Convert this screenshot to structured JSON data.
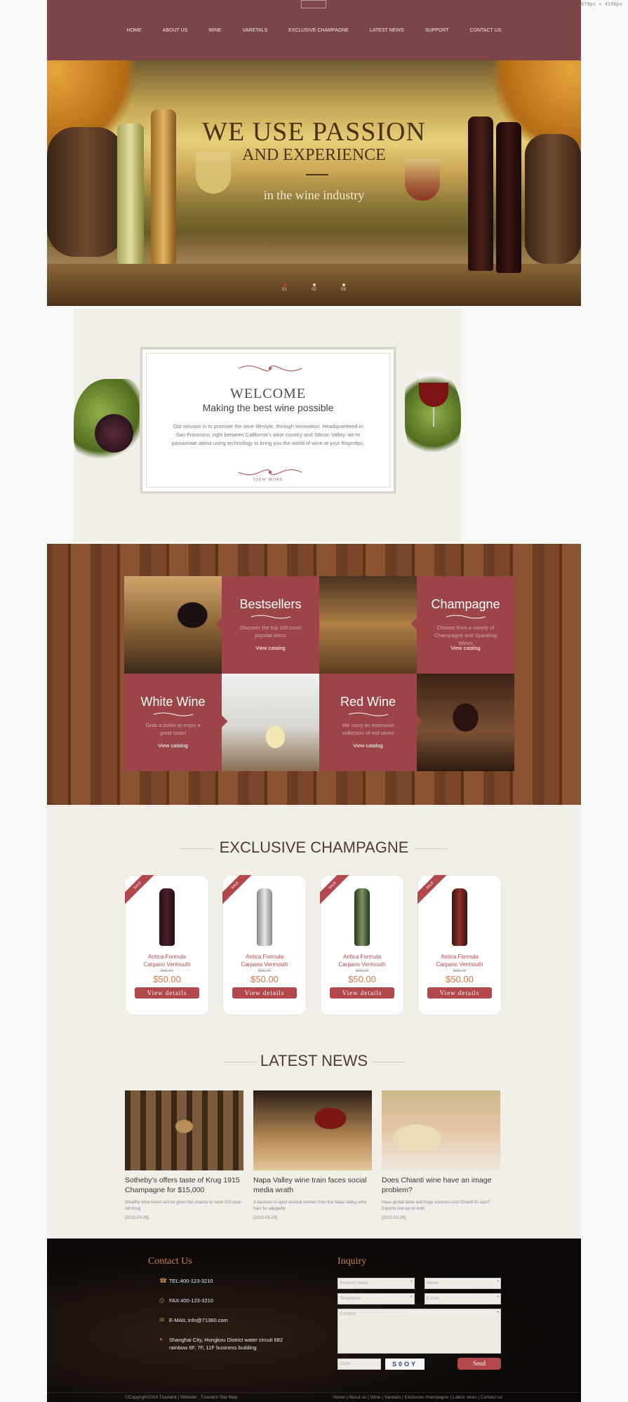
{
  "dims": "1679px × 4196px",
  "nav": [
    "HOME",
    "ABOUT US",
    "WINE",
    "VARETALS",
    "EXCLUSIVE CHAMPAGNE",
    "LATEST NEWS",
    "SUPPORT",
    "CONTACT US"
  ],
  "hero": {
    "title1": "WE USE PASSION",
    "title2": "AND EXPERIENCE",
    "subtitle": "in the wine industry",
    "slides": [
      "01",
      "02",
      "03"
    ]
  },
  "welcome": {
    "title": "WELCOME",
    "subtitle": "Making the best wine possible",
    "text": "Our mission is to promote the wine lifestyle, through innovation. Headquartered in San Francisco, right between California’s wine country and Silicon Valley, we’re passionate about using technology to bring you the world of wine at your fingertips.",
    "more": "VIEW MORE"
  },
  "categories": [
    {
      "title": "Bestsellers",
      "text": "Discover the top 100 most popular items",
      "cta": "View catalog"
    },
    {
      "title": "Champagne",
      "text": "Choose from a variety of Champagne and Sparkling Wines",
      "cta": "View catalog"
    },
    {
      "title": "White Wine",
      "text": "Grab a bottle to enjoy a great taste!",
      "cta": "View catalog"
    },
    {
      "title": "Red Wine",
      "text": "We carry an extensive collection of red wines",
      "cta": "View catalog"
    }
  ],
  "champagne": {
    "title": "EXCLUSIVE CHAMPAGNE",
    "products": [
      {
        "badge": "SALE",
        "name": "Antica Formula Carpano Vermouth",
        "old": "$65.00",
        "price": "$50.00",
        "btn": "View details"
      },
      {
        "badge": "SALE",
        "name": "Antica Formula Carpano Vermouth",
        "old": "$65.00",
        "price": "$50.00",
        "btn": "View details"
      },
      {
        "badge": "SALE",
        "name": "Antica Formula Carpano Vermouth",
        "old": "$65.00",
        "price": "$50.00",
        "btn": "View details"
      },
      {
        "badge": "SALE",
        "name": "Antica Formula Carpano Vermouth",
        "old": "$65.00",
        "price": "$50.00",
        "btn": "View details"
      }
    ]
  },
  "news": {
    "title": "LATEST NEWS",
    "items": [
      {
        "title": "Sotheby’s offers taste of Krug 1915 Champagne for $15,000",
        "text": "Wealthy wine lovers will be given the chance to taste 100-year-old Krug",
        "date": "[2015-03-29]"
      },
      {
        "title": "Napa Valley wine train faces social media wrath",
        "text": "A decision to eject several women from the Napa Valley wine train for allegedly",
        "date": "[2015-03-29]"
      },
      {
        "title": "Does Chianti wine have an image problem?",
        "text": "Have global fame and huge volumes cost Chianti its soul? Experts line up on both",
        "date": "[2015-03-29]"
      }
    ]
  },
  "footer": {
    "contact_title": "Contact Us",
    "contacts": [
      {
        "icon": "phone-icon",
        "text": "TEL:400-123-3210"
      },
      {
        "icon": "fax-icon",
        "text": "FAX:400-123-3210"
      },
      {
        "icon": "mail-icon",
        "text": "E-MAIL:info@71360.com"
      },
      {
        "icon": "location-icon",
        "text": "Shanghai City, Hongkou District water circuit 682 rainbow 6F, 7F, 11F business building"
      }
    ],
    "inquiry_title": "Inquiry",
    "form": {
      "product": "Product name",
      "name": "Name",
      "telephone": "Telephone",
      "email": "E-mail",
      "content": "Content",
      "code": "Code",
      "captcha": "S0OY",
      "send": "Send"
    },
    "copyright": "©Copyright2014 Truelaint | Website : Truelaint  Site Map",
    "links": "Home | About us | Wine | Varetals | Exclusive champagne | Latest news | Contact us"
  }
}
